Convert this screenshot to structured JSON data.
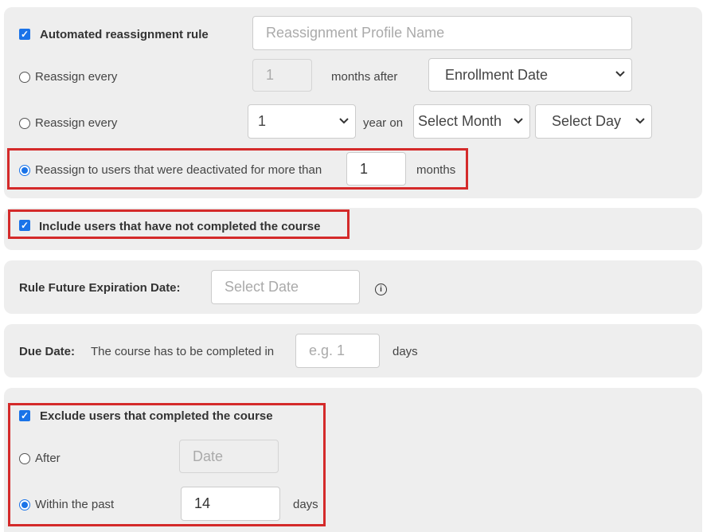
{
  "reassignment": {
    "automated_label": "Automated reassignment rule",
    "automated_checked": true,
    "profile_name_placeholder": "Reassignment Profile Name",
    "option1": {
      "label": "Reassign every",
      "value": "1",
      "unit": "months after",
      "date_field": "Enrollment Date",
      "selected": false
    },
    "option2": {
      "label": "Reassign every",
      "value": "1",
      "unit": "year on",
      "month": "Select Month",
      "day": "Select Day",
      "selected": false
    },
    "option3": {
      "label": "Reassign to users that were deactivated for more than",
      "value": "1",
      "unit": "months",
      "selected": true
    }
  },
  "include_incomplete": {
    "label": "Include users that have not completed the course",
    "checked": true
  },
  "expiration": {
    "label": "Rule Future Expiration Date:",
    "placeholder": "Select Date",
    "info_icon": "info-icon"
  },
  "due_date": {
    "label": "Due Date:",
    "text": "The course has to be completed in",
    "placeholder": "e.g. 1",
    "unit": "days"
  },
  "exclude": {
    "label": "Exclude users that completed the course",
    "checked": true,
    "after": {
      "label": "After",
      "placeholder": "Date",
      "selected": false
    },
    "within": {
      "label": "Within the past",
      "value": "14",
      "unit": "days",
      "selected": true
    }
  },
  "colors": {
    "accent": "#1a73e8",
    "highlight": "#d42a2a",
    "panel": "#eeeeee"
  }
}
